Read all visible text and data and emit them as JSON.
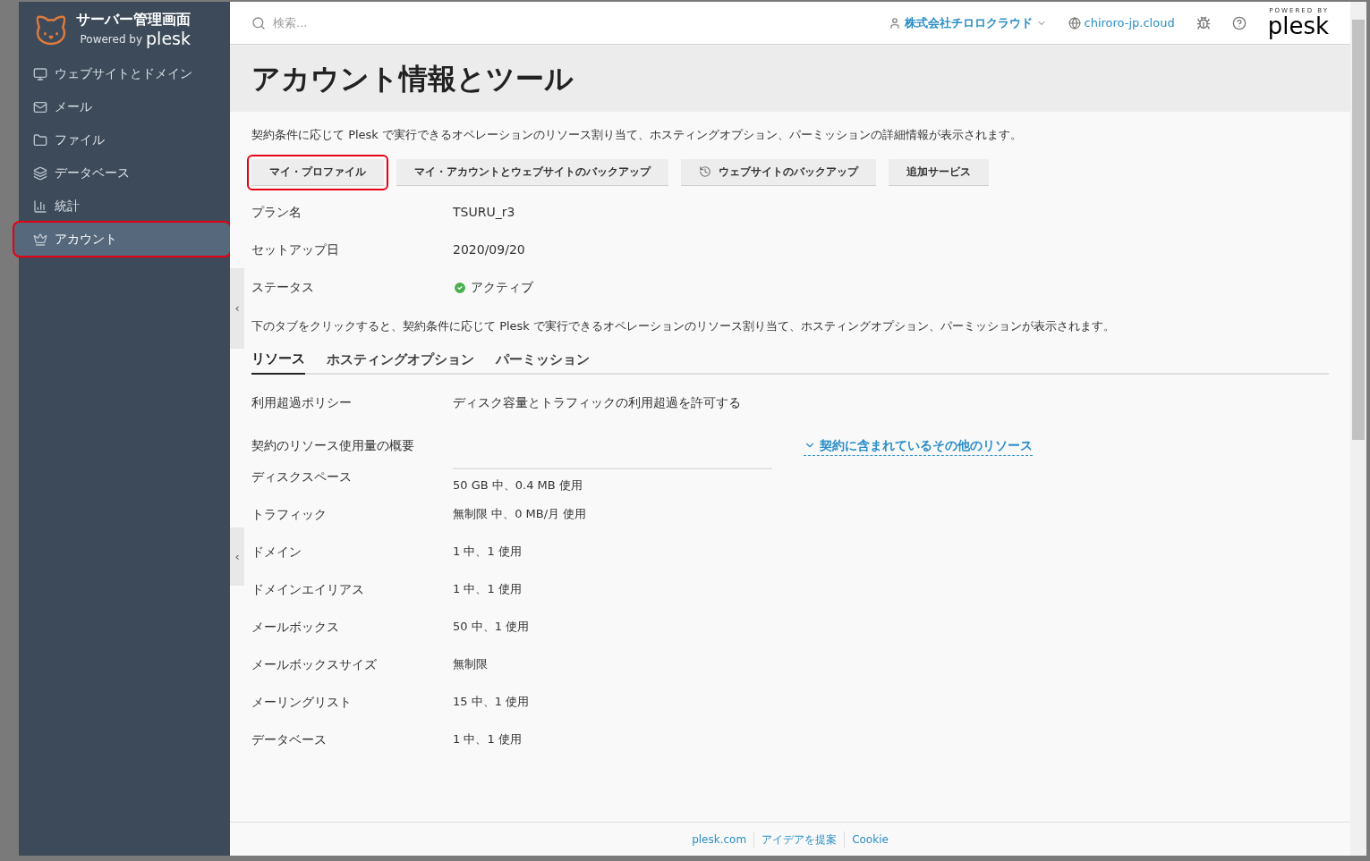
{
  "sidebar": {
    "title": "サーバー管理画面",
    "powered_by": "Powered by",
    "brand": "plesk",
    "items": [
      {
        "label": "ウェブサイトとドメイン",
        "kind": "monitor",
        "selected": false,
        "highlighted": false
      },
      {
        "label": "メール",
        "kind": "mail",
        "selected": false,
        "highlighted": false
      },
      {
        "label": "ファイル",
        "kind": "folder",
        "selected": false,
        "highlighted": false
      },
      {
        "label": "データベース",
        "kind": "layers",
        "selected": false,
        "highlighted": false
      },
      {
        "label": "統計",
        "kind": "chart",
        "selected": false,
        "highlighted": false
      },
      {
        "label": "アカウント",
        "kind": "crown",
        "selected": true,
        "highlighted": true
      }
    ]
  },
  "collapse_handles": [
    "‹",
    "‹"
  ],
  "header": {
    "search": {
      "placeholder": "検索..."
    },
    "account": "株式会社チロロクラウド",
    "domain": "chiroro-jp.cloud",
    "powered_by": "POWERED BY",
    "brand": "plesk"
  },
  "page": {
    "title": "アカウント情報とツール",
    "intro": "契約条件に応じて Plesk で実行できるオペレーションのリソース割り当て、ホスティングオプション、パーミッションの詳細情報が表示されます。",
    "buttons": [
      {
        "label": "マイ・プロファイル",
        "icon": false,
        "highlighted": true
      },
      {
        "label": "マイ・アカウントとウェブサイトのバックアップ",
        "icon": false,
        "highlighted": false
      },
      {
        "label": "ウェブサイトのバックアップ",
        "icon": true,
        "highlighted": false
      },
      {
        "label": "追加サービス",
        "icon": false,
        "highlighted": false
      }
    ],
    "info": [
      {
        "label": "プラン名",
        "value": "TSURU_r3",
        "kind": "text"
      },
      {
        "label": "セットアップ日",
        "value": "2020/09/20",
        "kind": "text"
      },
      {
        "label": "ステータス",
        "value": "アクティブ",
        "kind": "status"
      }
    ],
    "tabs_intro": "下のタブをクリックすると、契約条件に応じて Plesk で実行できるオペレーションのリソース割り当て、ホスティングオプション、パーミッションが表示されます。",
    "tabs": [
      {
        "label": "リソース",
        "selected": true
      },
      {
        "label": "ホスティングオプション",
        "selected": false
      },
      {
        "label": "パーミッション",
        "selected": false
      }
    ],
    "overuse": {
      "label": "利用超過ポリシー",
      "value": "ディスク容量とトラフィックの利用超過を許可する"
    },
    "summary": {
      "label": "契約のリソース使用量の概要",
      "link": "契約に含まれているその他のリソース"
    },
    "resources": [
      {
        "label": "ディスクスペース",
        "value": "50 GB 中、0.4 MB 使用",
        "kind": "bar",
        "level": 0
      },
      {
        "label": "トラフィック",
        "value": "無制限 中、0 MB/月 使用",
        "kind": "text"
      },
      {
        "label": "ドメイン",
        "value": "1 中、1 使用",
        "kind": "text"
      },
      {
        "label": "ドメインエイリアス",
        "value": "1 中、1 使用",
        "kind": "text"
      },
      {
        "label": "メールボックス",
        "value": "50 中、1 使用",
        "kind": "text"
      },
      {
        "label": "メールボックスサイズ",
        "value": "無制限",
        "kind": "text"
      },
      {
        "label": "メーリングリスト",
        "value": "15 中、1 使用",
        "kind": "text"
      },
      {
        "label": "データベース",
        "value": "1 中、1 使用",
        "kind": "text"
      }
    ]
  },
  "footer": [
    "plesk.com",
    "アイデアを提案",
    "Cookie"
  ]
}
